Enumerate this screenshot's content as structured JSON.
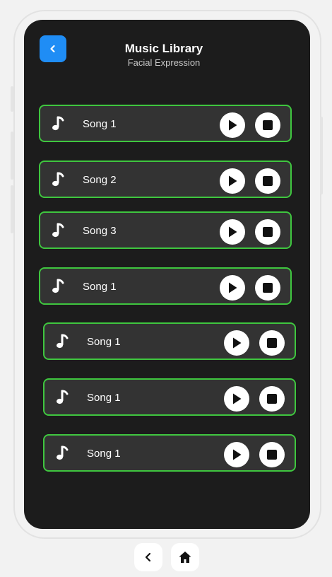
{
  "header": {
    "title": "Music Library",
    "subtitle": "Facial Expression"
  },
  "songs": [
    {
      "label": "Song 1"
    },
    {
      "label": "Song 2"
    },
    {
      "label": "Song 3"
    },
    {
      "label": "Song 1"
    },
    {
      "label": "Song 1"
    },
    {
      "label": "Song 1"
    },
    {
      "label": "Song 1"
    }
  ],
  "colors": {
    "accent": "#1f8df5",
    "row_border": "#3fc63f",
    "screen_bg": "#1c1c1c",
    "row_bg": "#333333"
  },
  "icons": {
    "back": "chevron-left-icon",
    "note": "music-note-icon",
    "play": "play-icon",
    "stop": "stop-icon",
    "nav_back": "chevron-left-icon",
    "nav_home": "home-icon"
  }
}
